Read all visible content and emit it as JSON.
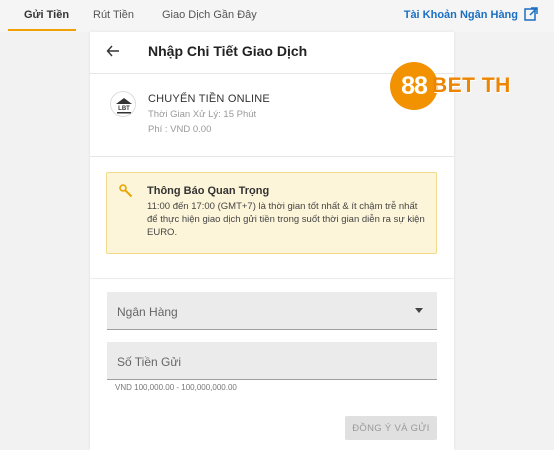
{
  "tabs": [
    {
      "label": "Gửi Tiền",
      "active": true
    },
    {
      "label": "Rút Tiền",
      "active": false
    },
    {
      "label": "Giao Dịch Gần Đây",
      "active": false
    }
  ],
  "account_link": "Tài Khoản Ngân Hàng",
  "card": {
    "title": "Nhập Chi Tiết Giao Dịch"
  },
  "method": {
    "logo_text": "LBT",
    "name": "CHUYỂN TIỀN ONLINE",
    "processing_time": "Thời Gian Xử Lý: 15 Phút",
    "fee": "Phí : VND 0.00"
  },
  "notice": {
    "title": "Thông Báo Quan Trọng",
    "text": "11:00 đến 17:00 (GMT+7) là thời gian tốt nhất & ít chậm trễ nhất để thực hiện giao dịch gửi tiền trong suốt thời gian diễn ra sự kiện EURO."
  },
  "form": {
    "bank_label": "Ngân Hàng",
    "amount_label": "Số Tiền Gửi",
    "amount_hint": "VND 100,000.00 - 100,000,000.00",
    "submit_label": "ĐỒNG Ý VÀ GỬI"
  },
  "brand": {
    "number": "88",
    "text": "BET TH"
  },
  "colors": {
    "accent": "#f0a000",
    "link": "#1a6fc2",
    "notice_bg": "#fdf5d9",
    "brand_orange": "#f39200"
  }
}
